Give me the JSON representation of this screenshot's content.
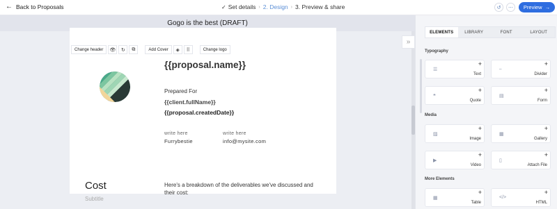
{
  "header": {
    "back_label": "Back to Proposals",
    "steps": [
      {
        "label": "Set details",
        "done": true
      },
      {
        "label": "2. Design",
        "active": true
      },
      {
        "label": "3. Preview & share"
      }
    ],
    "preview_label": "Preview"
  },
  "document": {
    "title": "Gogo is the best (DRAFT)",
    "toolbar": {
      "change_header": "Change header",
      "add_cover": "Add Cover",
      "change_logo": "Change logo"
    },
    "proposal_name": "{{proposal.name}}",
    "prepared_for": "Prepared For",
    "client_full_name": "{{client.fullName}}",
    "created_date": "{{proposal.createdDate}}",
    "contacts": [
      {
        "label": "write here",
        "value": "Furrybestie"
      },
      {
        "label": "write here",
        "value": "info@mysite.com"
      }
    ],
    "cost_title": "Cost",
    "cost_subtitle": "Subtitle",
    "cost_text": "Here's a breakdown of the deliverables we've discussed and their cost:"
  },
  "panel": {
    "tabs": [
      "ELEMENTS",
      "LIBRARY",
      "FONT",
      "LAYOUT"
    ],
    "active_tab": "ELEMENTS",
    "sections": [
      {
        "title": "Typography",
        "items": [
          {
            "label": "Text",
            "icon": "text-icon"
          },
          {
            "label": "Divider",
            "icon": "divider-icon"
          },
          {
            "label": "Quote",
            "icon": "quote-icon"
          },
          {
            "label": "Form",
            "icon": "form-icon"
          }
        ]
      },
      {
        "title": "Media",
        "items": [
          {
            "label": "Image",
            "icon": "image-icon"
          },
          {
            "label": "Gallery",
            "icon": "gallery-icon"
          },
          {
            "label": "Video",
            "icon": "video-icon"
          },
          {
            "label": "Attach File",
            "icon": "file-icon"
          }
        ]
      },
      {
        "title": "More Elements",
        "items": [
          {
            "label": "Table",
            "icon": "table-icon"
          },
          {
            "label": "HTML",
            "icon": "html-icon"
          }
        ]
      }
    ]
  },
  "colors": {
    "accent": "#2e6de0",
    "active_step": "#5b8fd6",
    "logo_stripes": [
      "#f2d59a",
      "#b8e2c2",
      "#7cc6a0",
      "#4aa98a",
      "#2f7f68",
      "#1f5f52"
    ]
  }
}
